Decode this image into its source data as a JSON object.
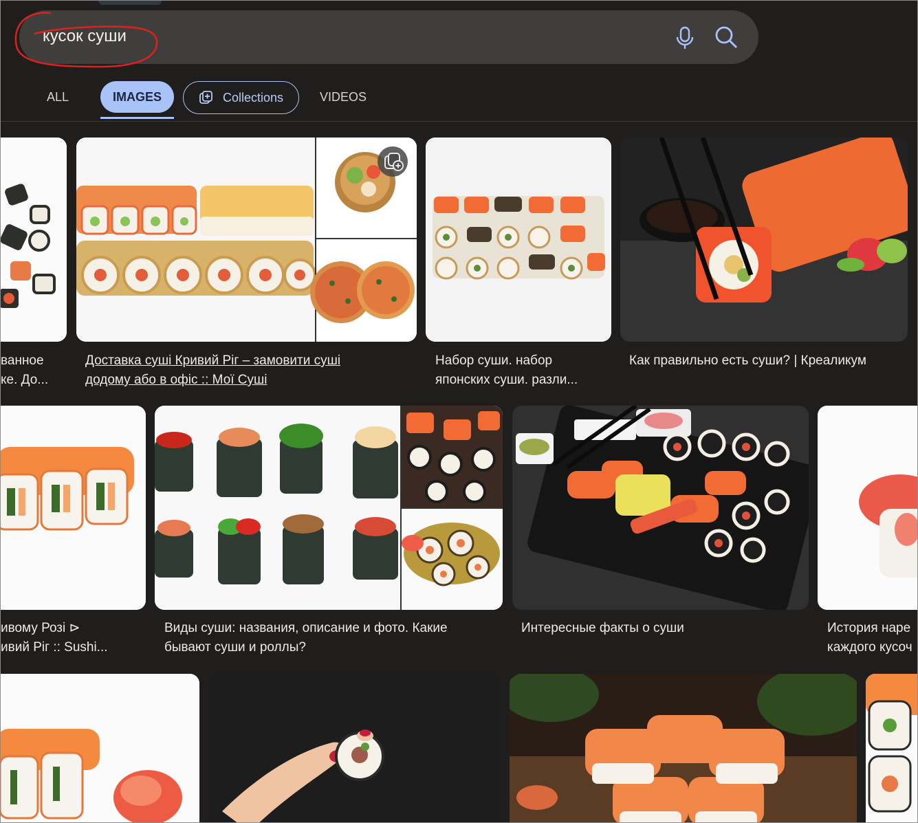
{
  "search": {
    "query": "кусок суши"
  },
  "tabs": {
    "all": "ALL",
    "images": "IMAGES",
    "collections": "Collections",
    "videos": "VIDEOS"
  },
  "results": {
    "row1": [
      {
        "caption_l1": "ванное",
        "caption_l2": "ке. До..."
      },
      {
        "caption_l1": "Доставка суші Кривий Ріг – замовити суші",
        "caption_l2": "додому або в офіс :: Мої Суші"
      },
      {
        "caption_l1": "Набор суши. набор",
        "caption_l2": "японских суши. разли..."
      },
      {
        "caption_l1": "Как правильно есть суши? | Креаликум",
        "caption_l2": ""
      }
    ],
    "row2": [
      {
        "caption_l1": "ивому Розі ⊳",
        "caption_l2": "ивий Ріг :: Sushi..."
      },
      {
        "caption_l1": "Виды суши: названия, описание и фото. Какие",
        "caption_l2": "бывают суши и роллы?"
      },
      {
        "caption_l1": "Интересные факты о суши",
        "caption_l2": ""
      },
      {
        "caption_l1": "История наре",
        "caption_l2": "каждого кусоч"
      }
    ]
  },
  "icons": {
    "mic": "microphone-icon",
    "search": "search-icon",
    "collections": "collections-add-icon",
    "collect": "add-to-collection-icon"
  },
  "colors": {
    "accent": "#a9c2f7",
    "background": "#1f1e1d",
    "annotation": "#e0201c"
  }
}
